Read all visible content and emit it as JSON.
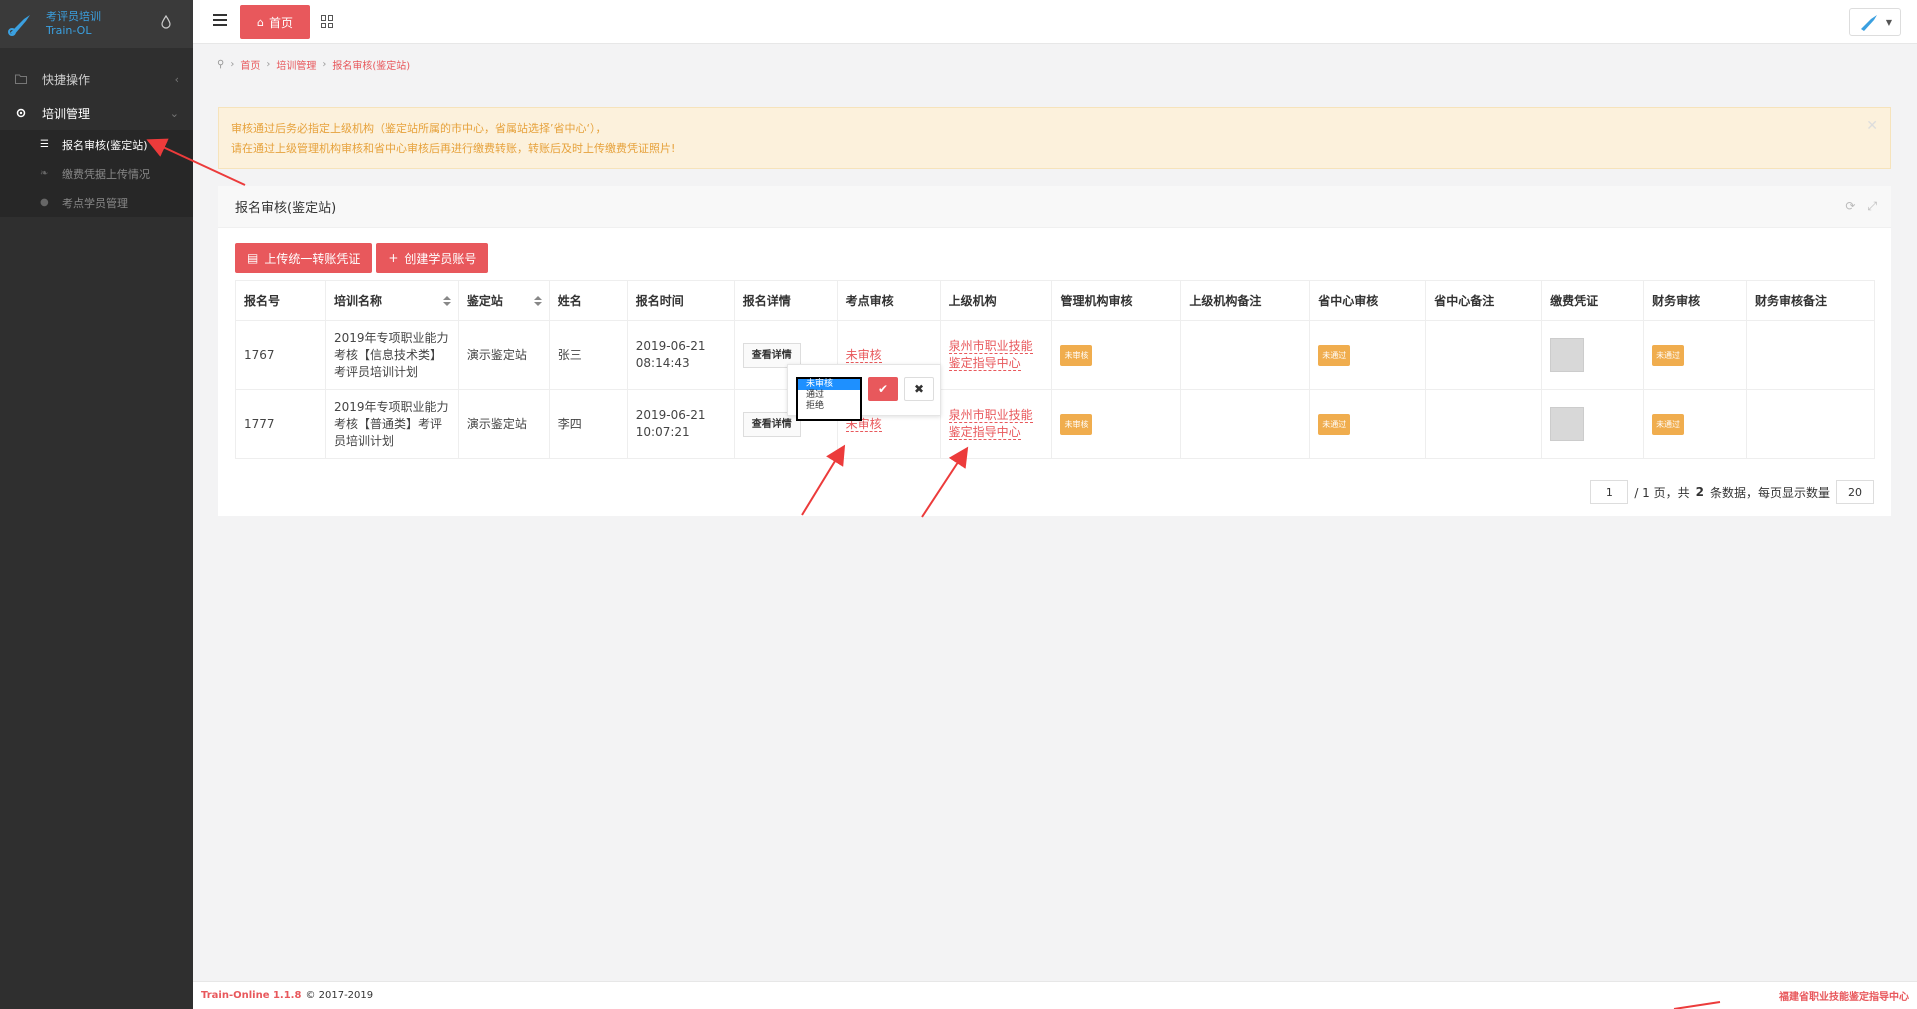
{
  "app": {
    "name_cn": "考评员培训",
    "name_en": "Train-OL"
  },
  "sidebar": {
    "items": [
      {
        "label": "快捷操作",
        "icon": "folder-icon"
      },
      {
        "label": "培训管理",
        "icon": "gear-icon"
      }
    ],
    "subitems": [
      {
        "label": "报名审核(鉴定站)",
        "icon": "list-icon"
      },
      {
        "label": "缴费凭据上传情况",
        "icon": "leaf-icon"
      },
      {
        "label": "考点学员管理",
        "icon": "user-icon"
      }
    ]
  },
  "topbar": {
    "home_label": "首页"
  },
  "breadcrumb": {
    "home": "首页",
    "section": "培训管理",
    "current": "报名审核(鉴定站)"
  },
  "alert": {
    "line1": "审核通过后务必指定上级机构（鉴定站所属的市中心，省属站选择’省中心‘），",
    "line2": "请在通过上级管理机构审核和省中心审核后再进行缴费转账，转账后及时上传缴费凭证照片!"
  },
  "panel": {
    "title": "报名审核(鉴定站)",
    "btn_upload": "上传统一转账凭证",
    "btn_create": "创建学员账号"
  },
  "table": {
    "headers": [
      "报名号",
      "培训名称",
      "鉴定站",
      "姓名",
      "报名时间",
      "报名详情",
      "考点审核",
      "上级机构",
      "管理机构审核",
      "上级机构备注",
      "省中心审核",
      "省中心备注",
      "缴费凭证",
      "财务审核",
      "财务审核备注"
    ],
    "rows": [
      {
        "id": "1767",
        "name": "2019年专项职业能力考核【信息技术类】考评员培训计划",
        "station": "演示鉴定站",
        "person": "张三",
        "time": "2019-06-21 08:14:43",
        "detail_btn": "查看详情",
        "site_review": "未审核",
        "superior": "泉州市职业技能鉴定指导中心",
        "mgmt_review": "未审核",
        "prov_review": "未通过",
        "finance_review": "未通过"
      },
      {
        "id": "1777",
        "name": "2019年专项职业能力考核【普通类】考评员培训计划",
        "station": "演示鉴定站",
        "person": "李四",
        "time": "2019-06-21 10:07:21",
        "detail_btn": "查看详情",
        "site_review": "未审核",
        "superior": "泉州市职业技能鉴定指导中心",
        "mgmt_review": "未审核",
        "prov_review": "未通过",
        "finance_review": "未通过"
      }
    ]
  },
  "popover": {
    "options": [
      "未审核",
      "通过",
      "拒绝"
    ],
    "selected": "未审核"
  },
  "pagination": {
    "page": "1",
    "text_total_pages": "/ 1 页，共",
    "count": "2",
    "text_records": "条数据，每页显示数量",
    "page_size": "20"
  },
  "footer": {
    "brand": "Train-Online 1.1.8",
    "copyright": "© 2017-2019",
    "org": "福建省职业技能鉴定指导中心"
  },
  "colors": {
    "accent": "#e8585c",
    "sidebar": "#2f2f2f",
    "warning": "#f0ad4e",
    "alert_bg": "#fcf1dc"
  }
}
